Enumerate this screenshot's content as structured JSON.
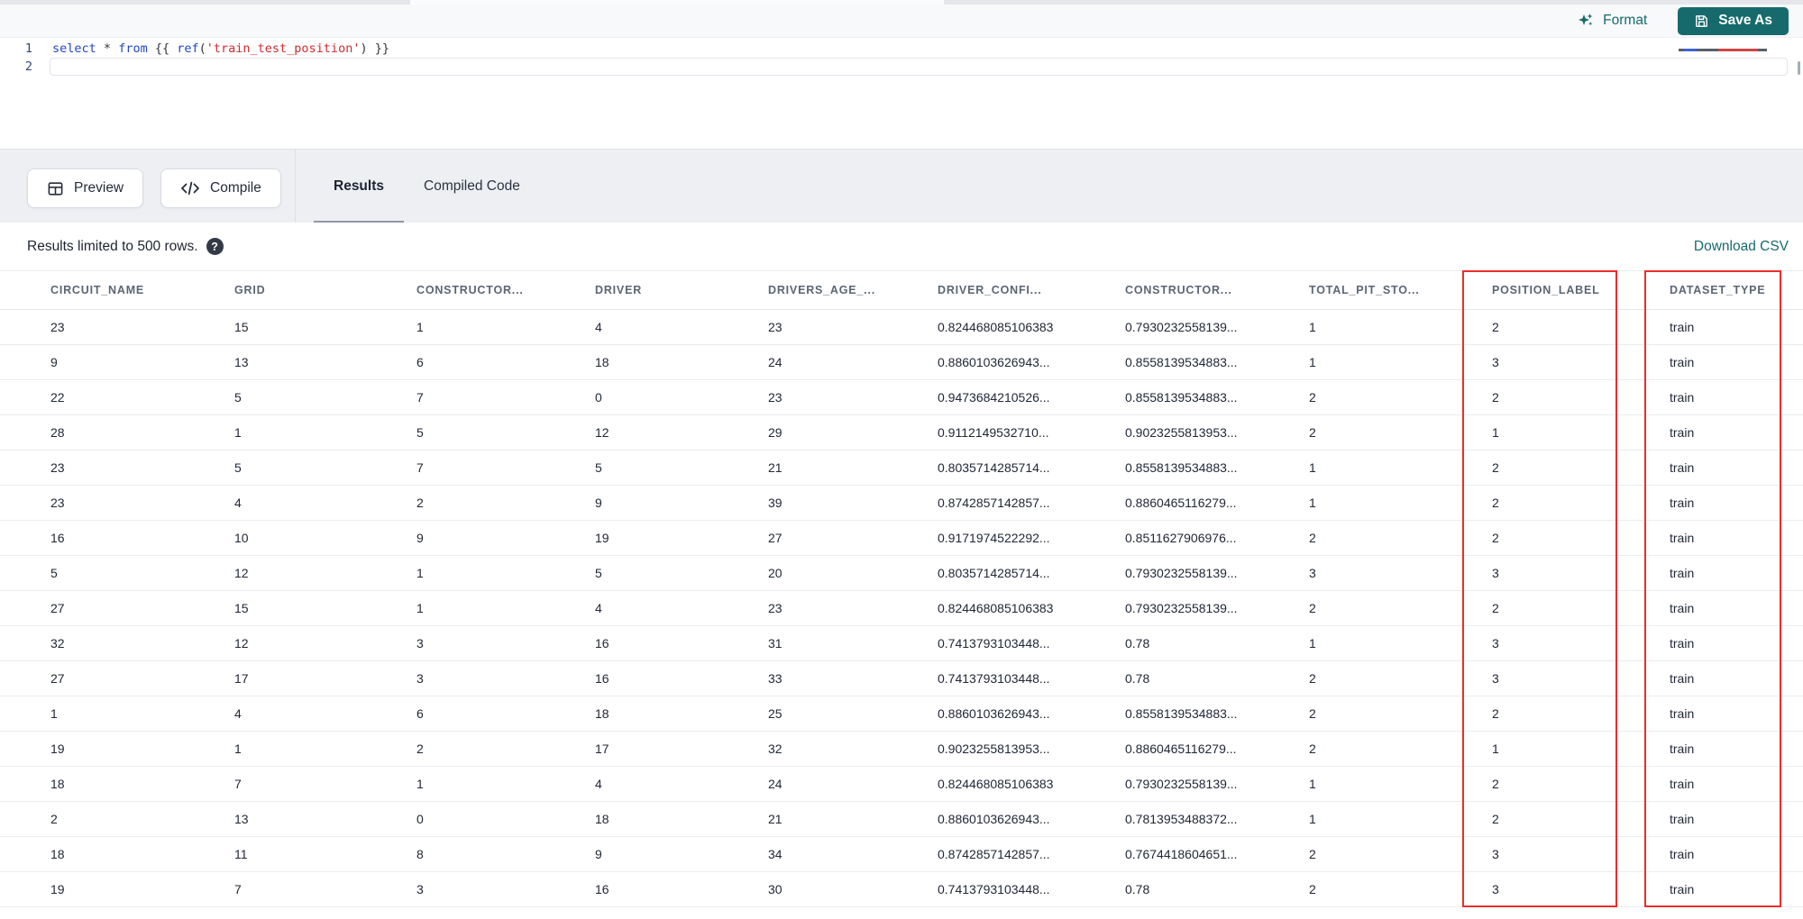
{
  "colors": {
    "accent_teal": "#166a6c",
    "highlight_red": "#ee2c2c"
  },
  "toolbar": {
    "format_label": "Format",
    "save_as_label": "Save As"
  },
  "editor": {
    "line1_number": "1",
    "line2_number": "2",
    "code_tokens": [
      {
        "text": "select",
        "type": "keyword"
      },
      {
        "text": " ",
        "type": "plain"
      },
      {
        "text": "*",
        "type": "plain"
      },
      {
        "text": " ",
        "type": "plain"
      },
      {
        "text": "from",
        "type": "keyword"
      },
      {
        "text": " {{ ",
        "type": "plain"
      },
      {
        "text": "ref",
        "type": "function"
      },
      {
        "text": "(",
        "type": "plain"
      },
      {
        "text": "'train_test_position'",
        "type": "string"
      },
      {
        "text": ") }}",
        "type": "plain"
      }
    ]
  },
  "action_bar": {
    "preview_label": "Preview",
    "compile_label": "Compile"
  },
  "tabs": [
    {
      "label": "Results",
      "active": true
    },
    {
      "label": "Compiled Code",
      "active": false
    }
  ],
  "results_bar": {
    "limit_text": "Results limited to 500 rows.",
    "help_glyph": "?",
    "download_label": "Download CSV"
  },
  "table": {
    "columns": [
      "CIRCUIT_NAME",
      "GRID",
      "CONSTRUCTOR...",
      "DRIVER",
      "DRIVERS_AGE_...",
      "DRIVER_CONFI...",
      "CONSTRUCTOR...",
      "TOTAL_PIT_STO...",
      "POSITION_LABEL",
      "DATASET_TYPE"
    ],
    "highlighted_columns": [
      "POSITION_LABEL",
      "DATASET_TYPE"
    ],
    "rows": [
      [
        "23",
        "15",
        "1",
        "4",
        "23",
        "0.824468085106383",
        "0.7930232558139...",
        "1",
        "2",
        "train"
      ],
      [
        "9",
        "13",
        "6",
        "18",
        "24",
        "0.8860103626943...",
        "0.8558139534883...",
        "1",
        "3",
        "train"
      ],
      [
        "22",
        "5",
        "7",
        "0",
        "23",
        "0.9473684210526...",
        "0.8558139534883...",
        "2",
        "2",
        "train"
      ],
      [
        "28",
        "1",
        "5",
        "12",
        "29",
        "0.9112149532710...",
        "0.9023255813953...",
        "2",
        "1",
        "train"
      ],
      [
        "23",
        "5",
        "7",
        "5",
        "21",
        "0.8035714285714...",
        "0.8558139534883...",
        "1",
        "2",
        "train"
      ],
      [
        "23",
        "4",
        "2",
        "9",
        "39",
        "0.8742857142857...",
        "0.8860465116279...",
        "1",
        "2",
        "train"
      ],
      [
        "16",
        "10",
        "9",
        "19",
        "27",
        "0.9171974522292...",
        "0.8511627906976...",
        "2",
        "2",
        "train"
      ],
      [
        "5",
        "12",
        "1",
        "5",
        "20",
        "0.8035714285714...",
        "0.7930232558139...",
        "3",
        "3",
        "train"
      ],
      [
        "27",
        "15",
        "1",
        "4",
        "23",
        "0.824468085106383",
        "0.7930232558139...",
        "2",
        "2",
        "train"
      ],
      [
        "32",
        "12",
        "3",
        "16",
        "31",
        "0.7413793103448...",
        "0.78",
        "1",
        "3",
        "train"
      ],
      [
        "27",
        "17",
        "3",
        "16",
        "33",
        "0.7413793103448...",
        "0.78",
        "2",
        "3",
        "train"
      ],
      [
        "1",
        "4",
        "6",
        "18",
        "25",
        "0.8860103626943...",
        "0.8558139534883...",
        "2",
        "2",
        "train"
      ],
      [
        "19",
        "1",
        "2",
        "17",
        "32",
        "0.9023255813953...",
        "0.8860465116279...",
        "2",
        "1",
        "train"
      ],
      [
        "18",
        "7",
        "1",
        "4",
        "24",
        "0.824468085106383",
        "0.7930232558139...",
        "1",
        "2",
        "train"
      ],
      [
        "2",
        "13",
        "0",
        "18",
        "21",
        "0.8860103626943...",
        "0.7813953488372...",
        "1",
        "2",
        "train"
      ],
      [
        "18",
        "11",
        "8",
        "9",
        "34",
        "0.8742857142857...",
        "0.7674418604651...",
        "2",
        "3",
        "train"
      ],
      [
        "19",
        "7",
        "3",
        "16",
        "30",
        "0.7413793103448...",
        "0.78",
        "2",
        "3",
        "train"
      ]
    ]
  }
}
